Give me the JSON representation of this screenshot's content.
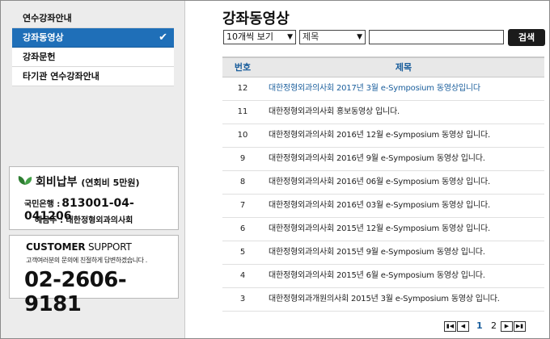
{
  "sidebar": {
    "items": [
      {
        "label": "연수강좌안내"
      },
      {
        "label": "강좌동영상"
      },
      {
        "label": "강좌문헌"
      },
      {
        "label": "타기관 연수강좌안내"
      }
    ],
    "active_index": 1
  },
  "fee": {
    "title": "회비납부",
    "subtitle": "(연회비 5만원)",
    "bank_label": "국민은행 :",
    "account": "813001-04-041206",
    "holder": "예금주 : 대한정형외과의사회"
  },
  "support": {
    "title_bold": "CUSTOMER",
    "title_rest": " SUPPORT",
    "desc": "고객여러분의 문의에 친절하게 답변하겠습니다 .",
    "phone": "02-2606-9181"
  },
  "main": {
    "title": "강좌동영상",
    "count_select": "10개씩 보기",
    "field_select": "제목",
    "search_value": "",
    "search_button": "검색",
    "table": {
      "headers": {
        "no": "번호",
        "title": "제목"
      },
      "rows": [
        {
          "no": "12",
          "title": "대한정형외과의사회 2017년 3월 e-Symposium 동영상입니다"
        },
        {
          "no": "11",
          "title": "대한정형외과의사회 홍보동영상 입니다."
        },
        {
          "no": "10",
          "title": "대한정형외과의사회 2016년 12월 e-Symposium 동영상 입니다."
        },
        {
          "no": "9",
          "title": "대한정형외과의사회 2016년 9월 e-Symposium 동영상 입니다."
        },
        {
          "no": "8",
          "title": "대한정형외과의사회 2016년 06월 e-Symposium 동영상 입니다."
        },
        {
          "no": "7",
          "title": "대한정형외과의사회 2016년 03월 e-Symposium 동영상 입니다."
        },
        {
          "no": "6",
          "title": "대한정형외과의사회 2015년 12월 e-Symposium 동영상 입니다."
        },
        {
          "no": "5",
          "title": "대한정형외과의사회 2015년 9월 e-Symposium 동영상 입니다."
        },
        {
          "no": "4",
          "title": "대한정형외과의사회 2015년 6월 e-Symposium 동영상 입니다."
        },
        {
          "no": "3",
          "title": "대한정형외과개원의사회 2015년 3월 e-Symposium 동영상 입니다."
        }
      ]
    },
    "pager": {
      "pages": [
        "1",
        "2"
      ],
      "current": "1"
    }
  },
  "colors": {
    "accent": "#1f6fb8",
    "link": "#1a5e9c",
    "sidebar_bg": "#ececec"
  },
  "icons": [
    "check-icon",
    "leaf-icon",
    "chevron-down-icon",
    "first-page-icon",
    "prev-page-icon",
    "next-page-icon",
    "last-page-icon"
  ]
}
